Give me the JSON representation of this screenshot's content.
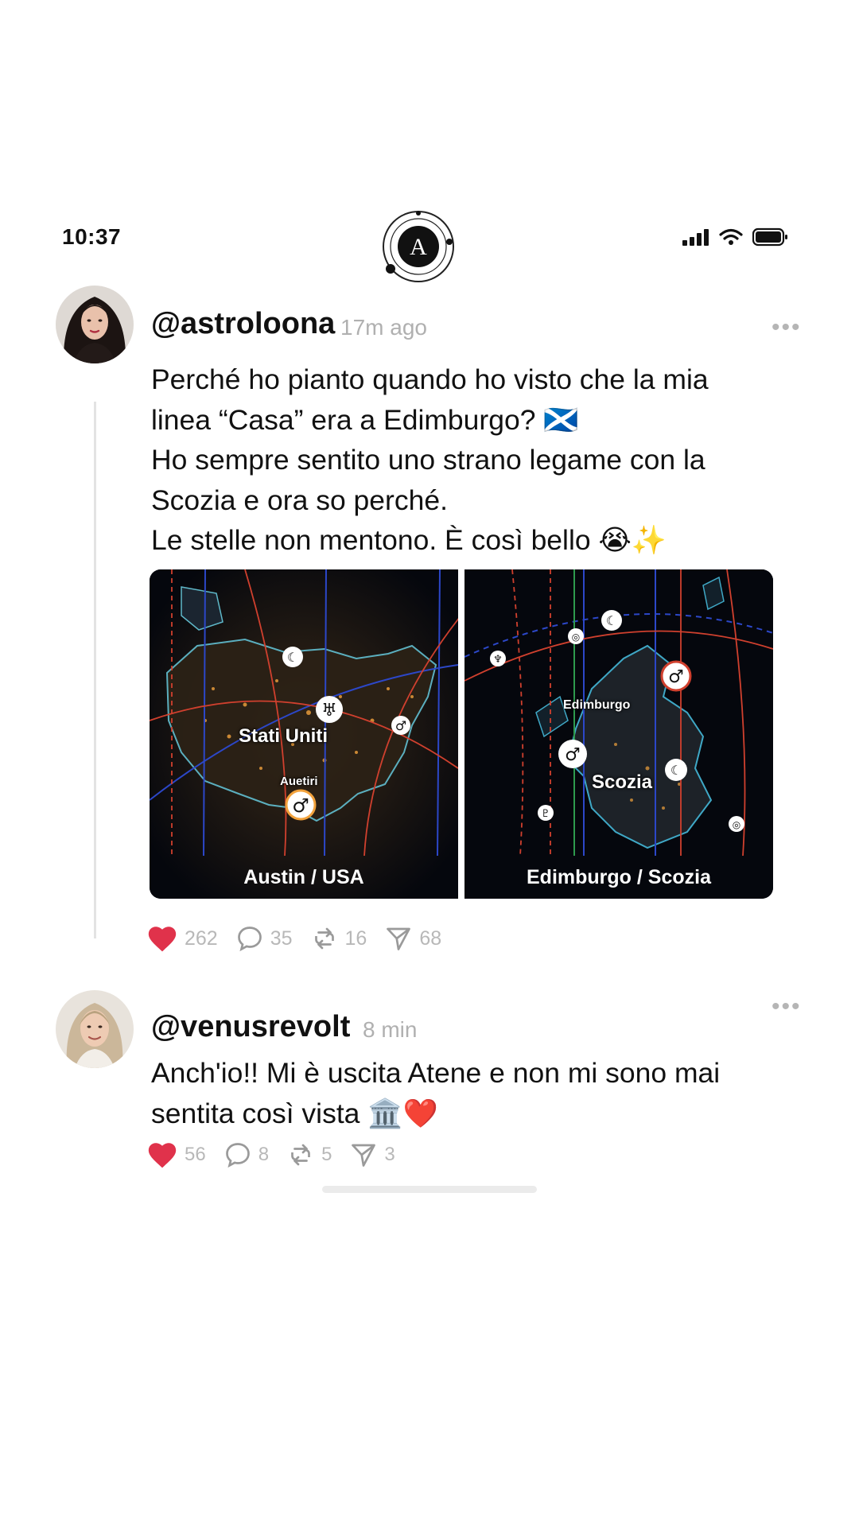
{
  "status_bar": {
    "time": "10:37",
    "logo_letter": "A"
  },
  "posts": [
    {
      "handle": "@astroloona",
      "time_ago": "17m ago",
      "more": "•••",
      "lines": [
        "Perché ho pianto quando ho visto che la mia",
        "linea “Casa” era a Edimburgo? 🏴󠁧󠁢󠁳󠁣󠁴󠁿",
        "Ho sempre sentito uno strano legame con la",
        "Scozia e ora so perché.",
        "Le stelle non mentono. È così bello 😭✨"
      ],
      "media": [
        {
          "caption": "Austin / USA",
          "labels": [
            "Stati Uniti",
            "Auetiri"
          ]
        },
        {
          "caption": "Edimburgo / Scozia",
          "labels": [
            "Edimburgo",
            "Scozia"
          ]
        }
      ],
      "actions": {
        "likes": "262",
        "comments": "35",
        "reposts": "16",
        "shares": "68"
      }
    },
    {
      "handle": "@venusrevolt",
      "time_ago": "8 min",
      "more": "•••",
      "lines": [
        "Anch'io!! Mi è uscita Atene e non mi sono mai",
        "sentita così vista 🏛️❤️"
      ],
      "actions": {
        "likes": "56",
        "comments": "8",
        "reposts": "5",
        "shares": "3"
      }
    }
  ],
  "colors": {
    "like": "#e0324b",
    "muted": "#b8b8b8",
    "map_bg": "#05070d"
  }
}
